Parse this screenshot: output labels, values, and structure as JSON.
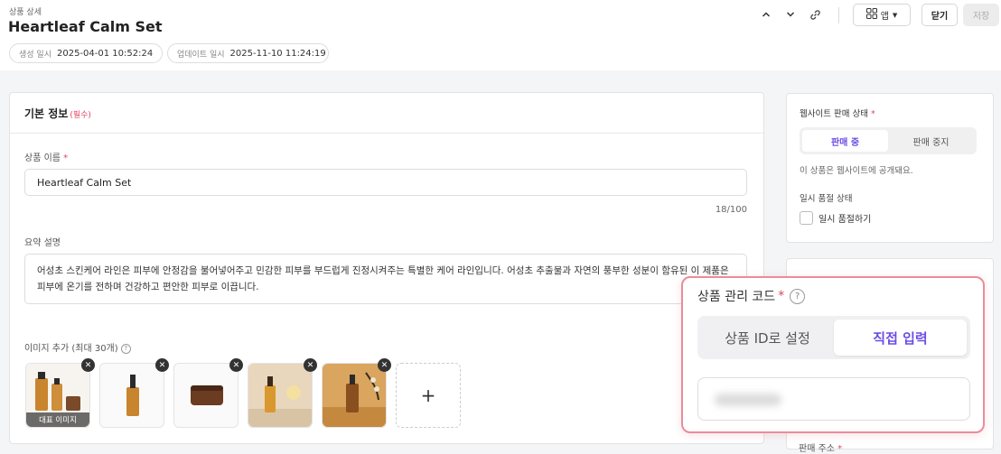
{
  "header": {
    "breadcrumb": "상품 상세",
    "title": "Heartleaf Calm Set",
    "created_label": "생성 일시",
    "created_value": "2025-04-01 10:52:24",
    "updated_label": "업데이트 일시",
    "updated_value": "2025-11-10 11:24:19",
    "app_label": "앱",
    "close_label": "닫기",
    "save_label": "저장",
    "icons": [
      "chevron-up-icon",
      "chevron-down-icon",
      "link-icon",
      "apps-icon"
    ]
  },
  "basic_info": {
    "title": "기본 정보",
    "required_tag": "(필수)",
    "name_label": "상품 이름",
    "required_star": "*",
    "name_value": "Heartleaf Calm Set",
    "name_counter": "18/100",
    "summary_label": "요약 설명",
    "summary_value": "어성초 스킨케어 라인은 피부에 안정감을 불어넣어주고 민감한 피부를 부드럽게 진정시켜주는 특별한 케어 라인입니다. 어성초 추출물과 자연의 풍부한 성분이 함유된 이 제품은 피부에 온기를 전하며 건강하고 편안한 피부로 이끕니다.",
    "images_label": "이미지 추가 (최대 30개)",
    "representative_label": "대표 이미지",
    "add_symbol": "+"
  },
  "sale_status": {
    "label": "웹사이트 판매 상태",
    "required_star": "*",
    "options": [
      "판매 중",
      "판매 중지"
    ],
    "selected": "판매 중",
    "hint": "이 상품은 웹사이트에 공개돼요.",
    "soldout_label": "일시 품절 상태",
    "soldout_checkbox": "일시 품절하기"
  },
  "code_popup": {
    "title": "상품 관리 코드",
    "required_star": "*",
    "options": [
      "상품 ID로 설정",
      "직접 입력"
    ],
    "selected": "직접 입력"
  },
  "bottom": {
    "label": "판매 주소",
    "required_star": "*"
  },
  "colors": {
    "accent": "#6b4de6",
    "required": "#e0455f",
    "highlight_border": "#ea8c9a"
  }
}
